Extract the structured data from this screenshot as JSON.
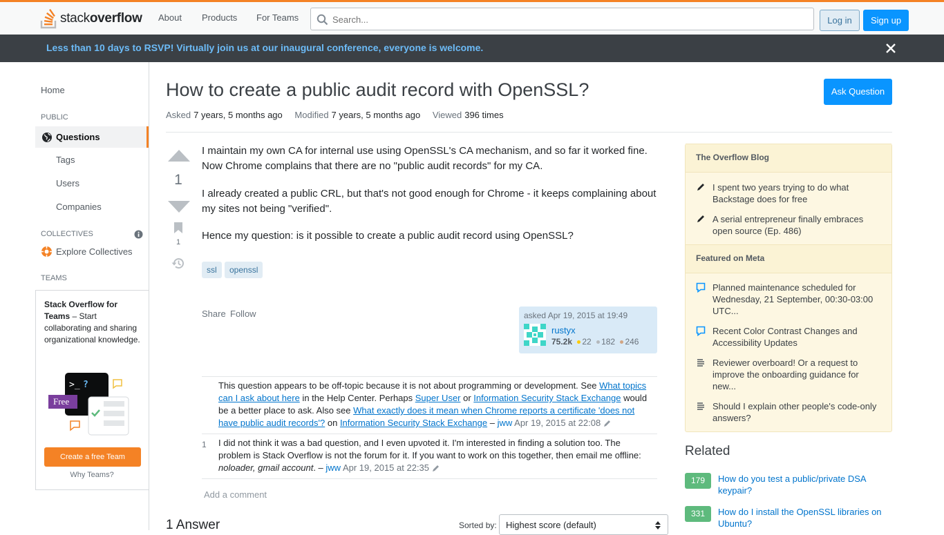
{
  "header": {
    "logo_text_regular": "stack",
    "logo_text_bold": "overflow",
    "nav": [
      "About",
      "Products",
      "For Teams"
    ],
    "search_placeholder": "Search...",
    "login_label": "Log in",
    "signup_label": "Sign up"
  },
  "banner": {
    "message": "Less than 10 days to RSVP! Virtually join us at our inaugural conference, everyone is welcome."
  },
  "sidebar": {
    "home": "Home",
    "public_heading": "PUBLIC",
    "questions": "Questions",
    "tags": "Tags",
    "users": "Users",
    "companies": "Companies",
    "collectives_heading": "COLLECTIVES",
    "explore_collectives": "Explore Collectives",
    "teams_heading": "TEAMS",
    "teams_title": "Stack Overflow for Teams",
    "teams_desc": " – Start collaborating and sharing organizational knowledge.",
    "teams_free_badge": "Free",
    "create_team": "Create a free Team",
    "why_teams": "Why Teams?"
  },
  "question": {
    "title": "How to create a public audit record with OpenSSL?",
    "ask_button": "Ask Question",
    "asked_label": "Asked",
    "asked_value": "7 years, 5 months ago",
    "modified_label": "Modified",
    "modified_value": "7 years, 5 months ago",
    "viewed_label": "Viewed",
    "viewed_value": "396 times",
    "score": "1",
    "bookmark_count": "1",
    "paragraphs": [
      "I maintain my own CA for internal use using OpenSSL's CA mechanism, and so far it worked fine. Now Chrome complains that there are no \"public audit records\" for my CA.",
      "I already created a public CRL, but that's not good enough for Chrome - it keeps complaining about my sites not being \"verified\".",
      "Hence my question: is it possible to create a public audit record using OpenSSL?"
    ],
    "tags": [
      "ssl",
      "openssl"
    ],
    "share_label": "Share",
    "follow_label": "Follow",
    "asked_when": "asked Apr 19, 2015 at 19:49",
    "user_name": "rustyx",
    "user_rep": "75.2k",
    "gold": "22",
    "silver": "182",
    "bronze": "246"
  },
  "comments": [
    {
      "score": "",
      "t1": "This question appears to be off-topic because it is not about programming or development. See ",
      "l1": "What topics can I ask about here",
      "t2": " in the Help Center. Perhaps ",
      "l2": "Super User",
      "t3": " or ",
      "l3": "Information Security Stack Exchange",
      "t4": " would be a better place to ask. Also see ",
      "l4": "What exactly does it mean when Chrome reports a certificate 'does not have public audit records'?",
      "t5": " on ",
      "l5": "Information Security Stack Exchange",
      "t6": " – ",
      "user": "jww",
      "date": "Apr 19, 2015 at 22:08"
    },
    {
      "score": "1",
      "t1": "I did not think it was a bad question, and I even upvoted it. I'm interested in finding a solution too. The problem is Stack Overflow is not the forum for it. If you want to work on this together, then email me offline: ",
      "em": "noloader, gmail account",
      "t2": ". – ",
      "user": "jww",
      "date": "Apr 19, 2015 at 22:35"
    }
  ],
  "add_comment": "Add a comment",
  "answers": {
    "count_label": "1 Answer",
    "sorted_by_label": "Sorted by:",
    "sort_value": "Highest score (default)"
  },
  "overflow_blog": {
    "heading": "The Overflow Blog",
    "items": [
      "I spent two years trying to do what Backstage does for free",
      "A serial entrepreneur finally embraces open source (Ep. 486)"
    ]
  },
  "featured_meta": {
    "heading": "Featured on Meta",
    "items": [
      "Planned maintenance scheduled for Wednesday, 21 September, 00:30-03:00 UTC...",
      "Recent Color Contrast Changes and Accessibility Updates",
      "Reviewer overboard! Or a request to improve the onboarding guidance for new...",
      "Should I explain other people's code-only answers?"
    ]
  },
  "related": {
    "heading": "Related",
    "items": [
      {
        "count": "179",
        "title": "How do you test a public/private DSA keypair?"
      },
      {
        "count": "331",
        "title": "How do I install the OpenSSL libraries on Ubuntu?"
      }
    ]
  },
  "colors": {
    "accent_orange": "#f48225",
    "primary_blue": "#0a95ff",
    "banner_bg": "#3b4045",
    "banner_text": "#6cbbf7",
    "related_green": "#5eba7d"
  }
}
